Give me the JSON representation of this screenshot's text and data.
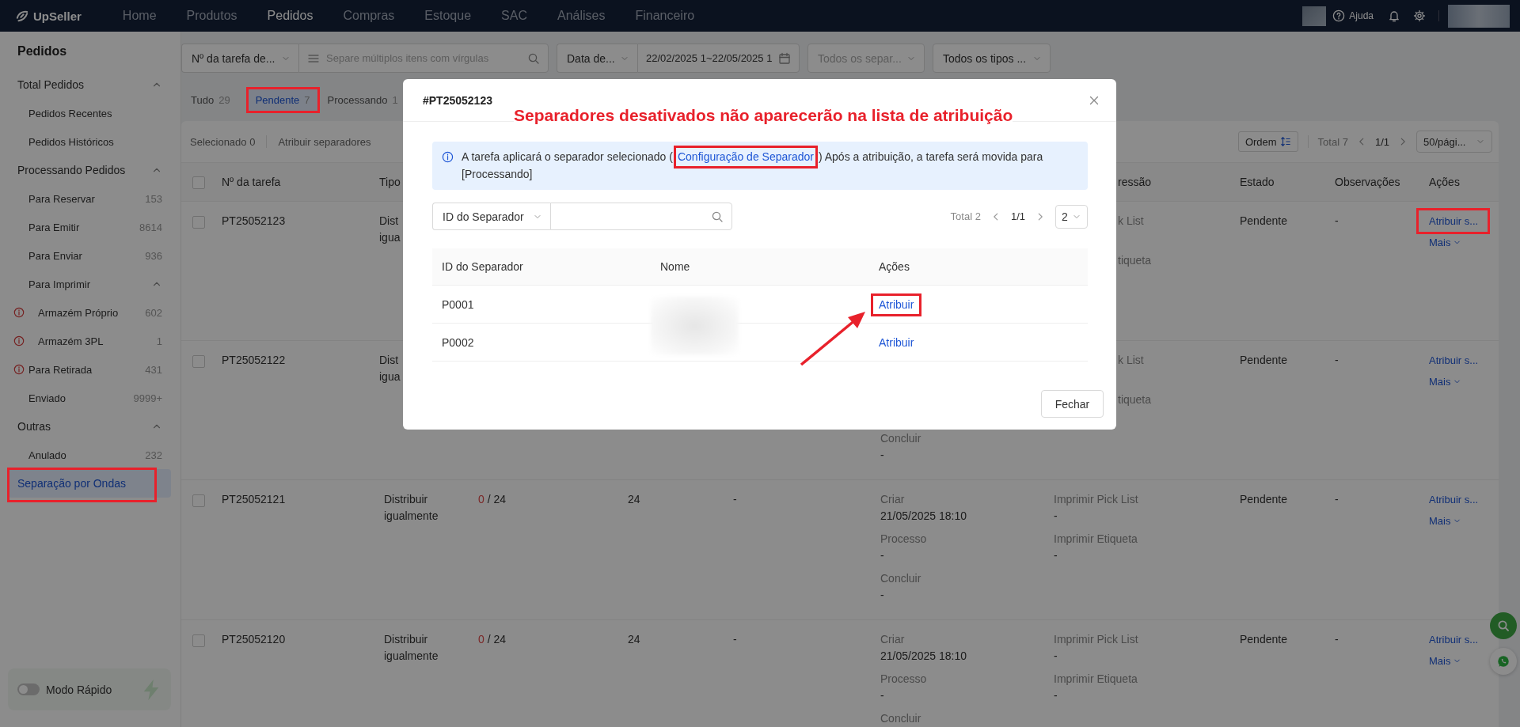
{
  "top_nav": {
    "brand": "UpSeller",
    "items": [
      {
        "label": "Home",
        "selected": false
      },
      {
        "label": "Produtos",
        "selected": false
      },
      {
        "label": "Pedidos",
        "selected": true
      },
      {
        "label": "Compras",
        "selected": false
      },
      {
        "label": "Estoque",
        "selected": false
      },
      {
        "label": "SAC",
        "selected": false
      },
      {
        "label": "Análises",
        "selected": false
      },
      {
        "label": "Financeiro",
        "selected": false
      }
    ],
    "help": "Ajuda"
  },
  "sidebar": {
    "title": "Pedidos",
    "items": [
      {
        "label": "Total Pedidos",
        "expanded": true,
        "selected": false,
        "highlighted": false,
        "children": [
          {
            "label": "Pedidos Recentes",
            "selected": false
          },
          {
            "label": "Pedidos Históricos",
            "selected": false
          }
        ]
      },
      {
        "label": "Processando Pedidos",
        "expanded": true,
        "selected": false,
        "highlighted": false,
        "children": [
          {
            "label": "Para Reservar",
            "count": "153",
            "warning": false,
            "selected": false
          },
          {
            "label": "Para Emitir",
            "count": "8614",
            "warning": false,
            "selected": false
          },
          {
            "label": "Para Enviar",
            "count": "936",
            "warning": false,
            "selected": false
          },
          {
            "label": "Para Imprimir",
            "expanded": true,
            "warning": false,
            "selected": false,
            "children": [
              {
                "label": "Armazém Próprio",
                "count": "602",
                "warning": true,
                "selected": false
              },
              {
                "label": "Armazém 3PL",
                "count": "1",
                "warning": true,
                "selected": false
              }
            ]
          },
          {
            "label": "Para Retirada",
            "count": "431",
            "warning": true,
            "selected": false
          },
          {
            "label": "Enviado",
            "count": "9999+",
            "warning": false,
            "selected": false
          }
        ]
      },
      {
        "label": "Outras",
        "expanded": true,
        "selected": false,
        "highlighted": false,
        "children": [
          {
            "label": "Anulado",
            "count": "232",
            "selected": false
          }
        ]
      },
      {
        "label": "Separação por Ondas",
        "selected": true,
        "highlighted": true
      }
    ],
    "quick_mode": {
      "label": "Modo Rápido",
      "on": false
    }
  },
  "filters": {
    "task_field": "Nº da tarefa de...",
    "search_placeholder": "Separe múltiplos itens com vírgulas",
    "date_field": "Data de...",
    "date_range": "22/02/2025 1~22/05/2025 1",
    "picker_placeholder": "Todos os separ...",
    "type_field": "Todos os tipos ..."
  },
  "status_tabs": [
    {
      "label": "Tudo",
      "count": "29",
      "selected": false,
      "highlighted": false
    },
    {
      "label": "Pendente",
      "count": "7",
      "selected": true,
      "highlighted": true
    },
    {
      "label": "Processando",
      "count": "1",
      "selected": false,
      "highlighted": false
    }
  ],
  "toolbar": {
    "selected_text": "Selecionado 0",
    "assign": "Atribuir separadores",
    "sort": "Ordem",
    "total": "Total 7",
    "page": "1/1",
    "page_size": "50/pági..."
  },
  "table": {
    "all_checked": false,
    "columns": {
      "task": "Nº da tarefa",
      "type": "Tipo",
      "print": "ressão",
      "state": "Estado",
      "notes": "Observações",
      "actions": "Ações"
    },
    "rows": [
      {
        "kind": "covered",
        "checked": false,
        "task": "PT25052123",
        "type_lines": [
          "Dist",
          "igua"
        ],
        "times": [],
        "prints": [
          {
            "label": "k List"
          },
          {
            "label": "tiqueta"
          }
        ],
        "state": "Pendente",
        "notes": "-",
        "action": "Atribuir s...",
        "action_highlighted": true,
        "more": "Mais"
      },
      {
        "kind": "covered",
        "checked": false,
        "task": "PT25052122",
        "type_lines": [
          "Dist",
          "igua"
        ],
        "times": [
          {
            "label": "Concluir",
            "value": "-"
          }
        ],
        "prints": [
          {
            "label": "k List"
          },
          {
            "label": "tiqueta"
          }
        ],
        "state": "Pendente",
        "notes": "-",
        "action": "Atribuir s...",
        "action_highlighted": false,
        "more": "Mais"
      },
      {
        "kind": "full",
        "checked": false,
        "task": "PT25052121",
        "type": "Distribuir igualmente",
        "done": "0",
        "rest": "/ 24",
        "qty": "24",
        "column_6": "-",
        "times": [
          {
            "label": "Criar",
            "value": "21/05/2025 18:10"
          },
          {
            "label": "Processo",
            "value": "-"
          },
          {
            "label": "Concluir",
            "value": "-"
          }
        ],
        "prints": [
          {
            "label": "Imprimir Pick List",
            "value": "-"
          },
          {
            "label": "Imprimir Etiqueta",
            "value": "-"
          }
        ],
        "state": "Pendente",
        "notes": "-",
        "action": "Atribuir s...",
        "action_highlighted": false,
        "more": "Mais"
      },
      {
        "kind": "full",
        "checked": false,
        "task": "PT25052120",
        "type": "Distribuir igualmente",
        "done": "0",
        "rest": "/ 24",
        "qty": "24",
        "column_6": "-",
        "times": [
          {
            "label": "Criar",
            "value": "21/05/2025 18:10"
          },
          {
            "label": "Processo",
            "value": "-"
          },
          {
            "label": "Concluir"
          }
        ],
        "prints": [
          {
            "label": "Imprimir Pick List",
            "value": "-"
          },
          {
            "label": "Imprimir Etiqueta",
            "value": "-"
          }
        ],
        "state": "Pendente",
        "notes": "-",
        "action": "Atribuir s...",
        "action_highlighted": false,
        "more": "Mais"
      }
    ]
  },
  "modal": {
    "title": "#PT25052123",
    "annotation": "Separadores desativados não aparecerão na lista de atribuição",
    "info": {
      "before": "A tarefa aplicará o separador selecionado (",
      "link": "Configuração de Separador",
      "link_highlighted": true,
      "after": ") Após a atribuição, a tarefa será movida para [Processando]"
    },
    "search_field": "ID do Separador",
    "total": "Total 2",
    "page": "1/1",
    "page_size": "2",
    "columns": [
      "ID do Separador",
      "Nome",
      "Ações"
    ],
    "rows": [
      {
        "id": "P0001",
        "action": "Atribuir",
        "highlighted": true
      },
      {
        "id": "P0002",
        "action": "Atribuir",
        "highlighted": false
      }
    ],
    "close_button": "Fechar"
  }
}
